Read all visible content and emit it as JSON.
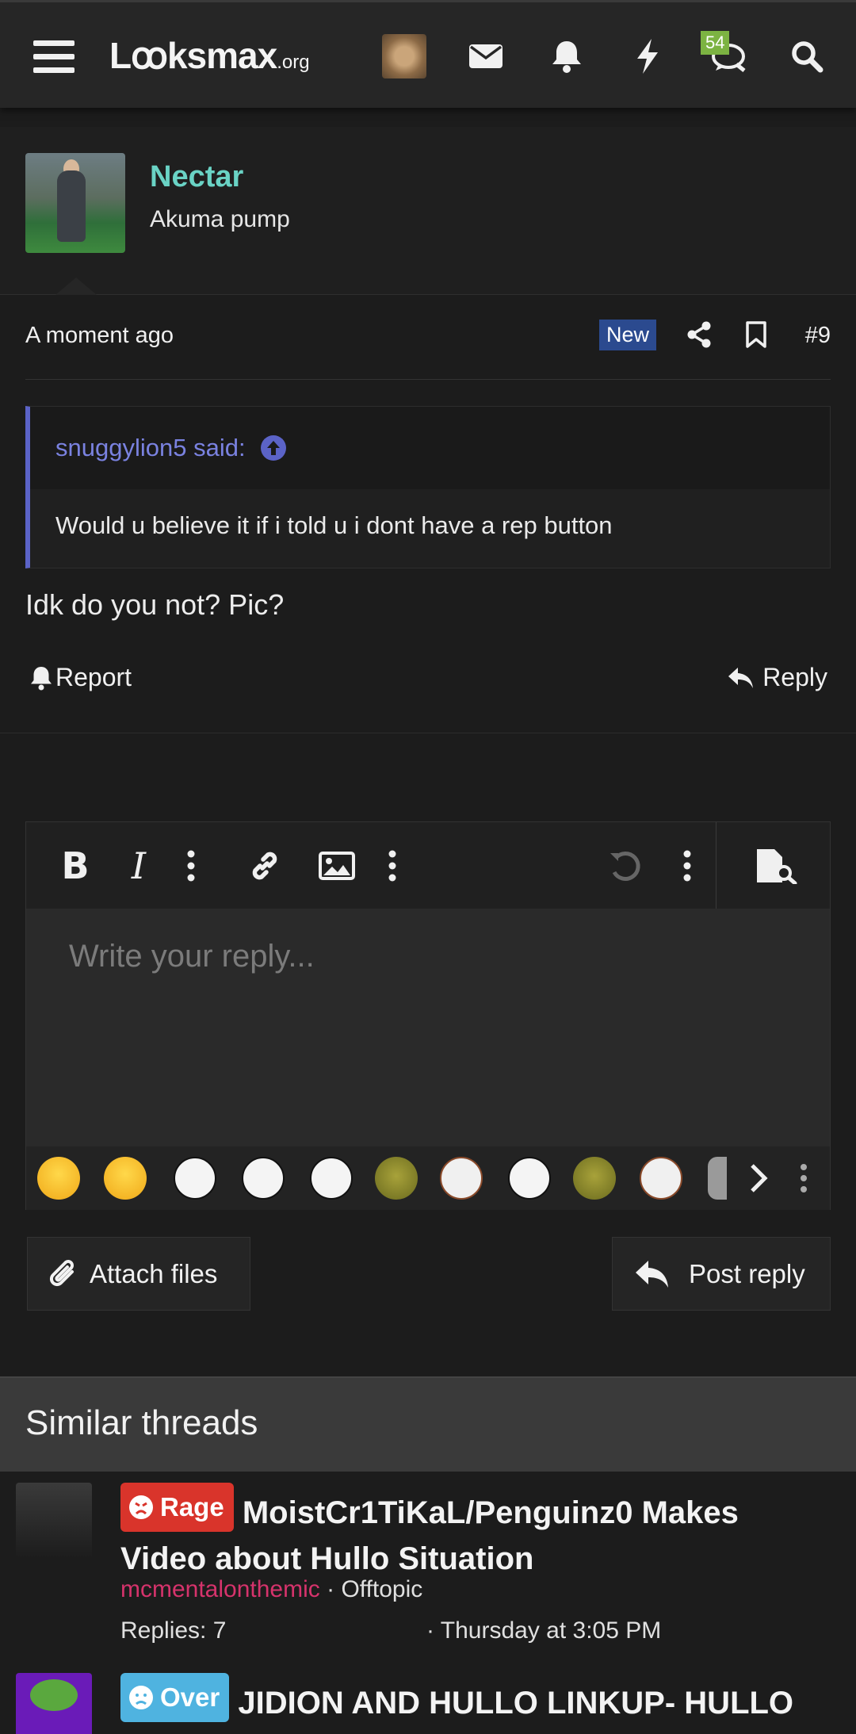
{
  "header": {
    "logo_main": "Lꝏksmax",
    "logo_suffix": ".org",
    "notification_count": "54"
  },
  "post": {
    "username": "Nectar",
    "user_title": "Akuma pump",
    "time": "A moment ago",
    "new_badge": "New",
    "post_number": "#9",
    "quote_author": "snuggylion5 said:",
    "quote_text": "Would u believe it if i told u i dont have a rep button",
    "message": "Idk do you not? Pic?",
    "report_label": "Report",
    "reply_label": "Reply"
  },
  "editor": {
    "placeholder": "Write your reply...",
    "attach_label": "Attach files",
    "post_label": "Post reply"
  },
  "similar": {
    "heading": "Similar threads",
    "threads": [
      {
        "prefix": "Rage",
        "prefix_color": "#d9342b",
        "title": "MoistCr1TiKaL/Penguinz0 Makes Video about Hullo Situation",
        "author": "mcmentalonthemic",
        "forum": "Offtopic",
        "replies": "Replies: 7",
        "date": "Thursday at 3:05 PM"
      },
      {
        "prefix": "Over",
        "prefix_color": "#4fb3e0",
        "title": "JIDION AND HULLO LINKUP- HULLO GUILTY? (TIKTOK VIDEO LINK) TIKTOKCELS",
        "author": "",
        "forum": "",
        "replies": "",
        "date": ""
      }
    ]
  }
}
